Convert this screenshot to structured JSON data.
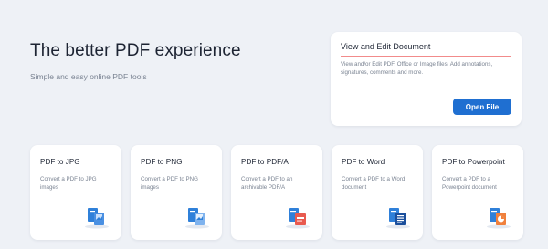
{
  "hero": {
    "title": "The better PDF experience",
    "subtitle": "Simple and easy online PDF tools"
  },
  "view_card": {
    "title": "View and Edit Document",
    "description": "View and/or Edit PDF, Office or Image files. Add annotations, signatures, comments and more.",
    "button_label": "Open File"
  },
  "tools": [
    {
      "title": "PDF to JPG",
      "description": "Convert a PDF to JPG images",
      "icon": "pdf-to-jpg-icon"
    },
    {
      "title": "PDF to PNG",
      "description": "Convert a PDF to PNG images",
      "icon": "pdf-to-png-icon"
    },
    {
      "title": "PDF to PDF/A",
      "description": "Convert a PDF to an archivable PDF/A",
      "icon": "pdf-to-pdfa-icon"
    },
    {
      "title": "PDF to Word",
      "description": "Convert a PDF to a Word document",
      "icon": "pdf-to-word-icon"
    },
    {
      "title": "PDF to Powerpoint",
      "description": "Convert a PDF to a Powerpoint document",
      "icon": "pdf-to-powerpoint-icon"
    }
  ],
  "colors": {
    "background": "#eef1f6",
    "accent_blue": "#1f6fd1",
    "pdf_red": "#e85a4f",
    "underline_red": "#f28b8b"
  }
}
